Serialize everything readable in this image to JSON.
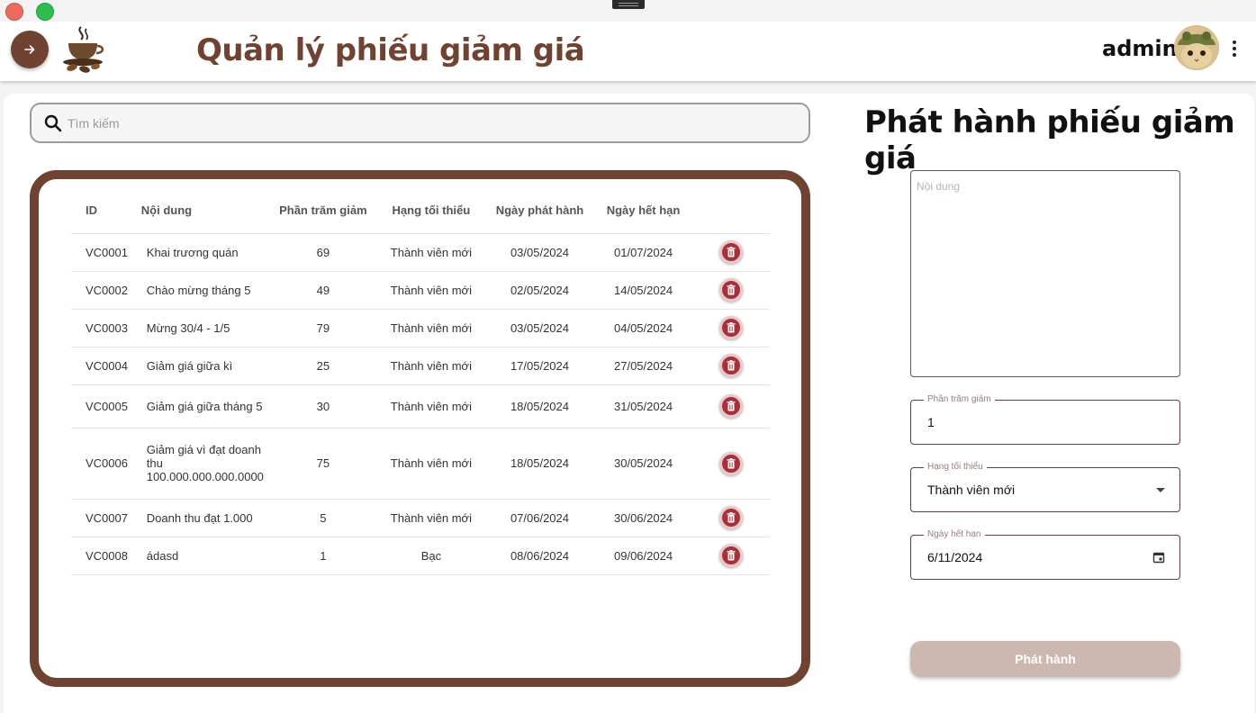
{
  "header": {
    "title": "Quản lý phiếu giảm giá",
    "username": "admin"
  },
  "search": {
    "placeholder": "Tìm kiếm"
  },
  "table": {
    "columns": [
      "ID",
      "Nội dung",
      "Phần trăm giảm",
      "Hạng tối thiểu",
      "Ngày phát hành",
      "Ngày hết hạn"
    ],
    "rows": [
      {
        "id": "VC0001",
        "content": "Khai trương quán",
        "percent": "69",
        "rank": "Thành viên mới",
        "issued": "03/05/2024",
        "expires": "01/07/2024"
      },
      {
        "id": "VC0002",
        "content": "Chào mừng tháng 5",
        "percent": "49",
        "rank": "Thành viên mới",
        "issued": "02/05/2024",
        "expires": "14/05/2024"
      },
      {
        "id": "VC0003",
        "content": "Mừng 30/4 - 1/5",
        "percent": "79",
        "rank": "Thành viên mới",
        "issued": "03/05/2024",
        "expires": "04/05/2024"
      },
      {
        "id": "VC0004",
        "content": "Giảm giá giữa kì",
        "percent": "25",
        "rank": "Thành viên mới",
        "issued": "17/05/2024",
        "expires": "27/05/2024"
      },
      {
        "id": "VC0005",
        "content": "Giảm giá giữa tháng 5",
        "percent": "30",
        "rank": "Thành viên mới",
        "issued": "18/05/2024",
        "expires": "31/05/2024"
      },
      {
        "id": "VC0006",
        "content": "Giảm giá vì đạt doanh thu 100.000.000.000.0000",
        "percent": "75",
        "rank": "Thành viên mới",
        "issued": "18/05/2024",
        "expires": "30/05/2024"
      },
      {
        "id": "VC0007",
        "content": "Doanh thu đạt 1.000",
        "percent": "5",
        "rank": "Thành viên mới",
        "issued": "07/06/2024",
        "expires": "30/06/2024"
      },
      {
        "id": "VC0008",
        "content": "ádasd",
        "percent": "1",
        "rank": "Bạc",
        "issued": "08/06/2024",
        "expires": "09/06/2024"
      }
    ]
  },
  "form": {
    "title": "Phát hành phiếu giảm giá",
    "content_placeholder": "Nội dung",
    "percent_label": "Phần trăm giảm",
    "percent_value": "1",
    "rank_label": "Hạng tối thiểu",
    "rank_value": "Thành viên mới",
    "expiry_label": "Ngày hết hạn",
    "expiry_value": "6/11/2024",
    "submit_label": "Phát hành"
  },
  "colors": {
    "brand": "#6f4232",
    "delete": "#a6313a",
    "submit_disabled": "#cdb8b1"
  },
  "icons": [
    "arrow-right-icon",
    "coffee-logo-icon",
    "more-vert-icon",
    "search-icon",
    "trash-icon",
    "dropdown-caret-icon",
    "calendar-icon"
  ]
}
